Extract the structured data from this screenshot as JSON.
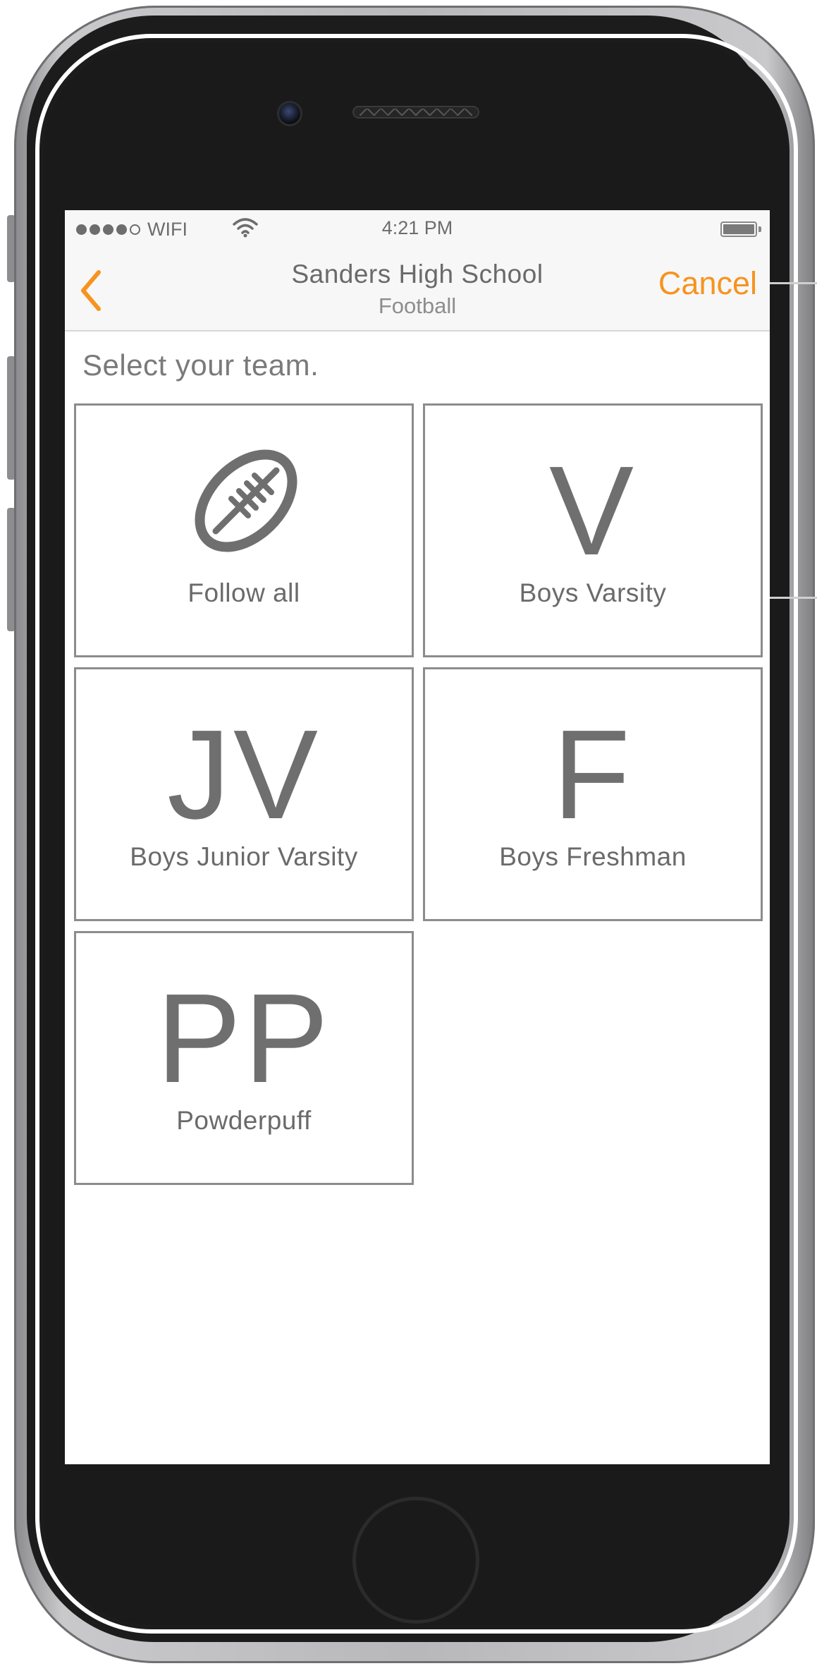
{
  "status_bar": {
    "carrier": "WIFI",
    "signal_bars": 4,
    "signal_total": 5,
    "time": "4:21 PM",
    "battery_level": 1.0
  },
  "nav": {
    "back_icon": "chevron-left-icon",
    "title": "Sanders High School",
    "subtitle": "Football",
    "cancel_label": "Cancel"
  },
  "prompt": "Select your team.",
  "teams": [
    {
      "icon": "football-icon",
      "label": "Follow all"
    },
    {
      "glyph": "V",
      "label": "Boys Varsity"
    },
    {
      "glyph": "JV",
      "label": "Boys Junior Varsity"
    },
    {
      "glyph": "F",
      "label": "Boys Freshman"
    },
    {
      "glyph": "PP",
      "label": "Powderpuff"
    }
  ],
  "colors": {
    "accent": "#f7931e",
    "text": "#6a6a6a",
    "tile_border": "#8c8c8c",
    "bar_background": "#f7f7f7"
  }
}
